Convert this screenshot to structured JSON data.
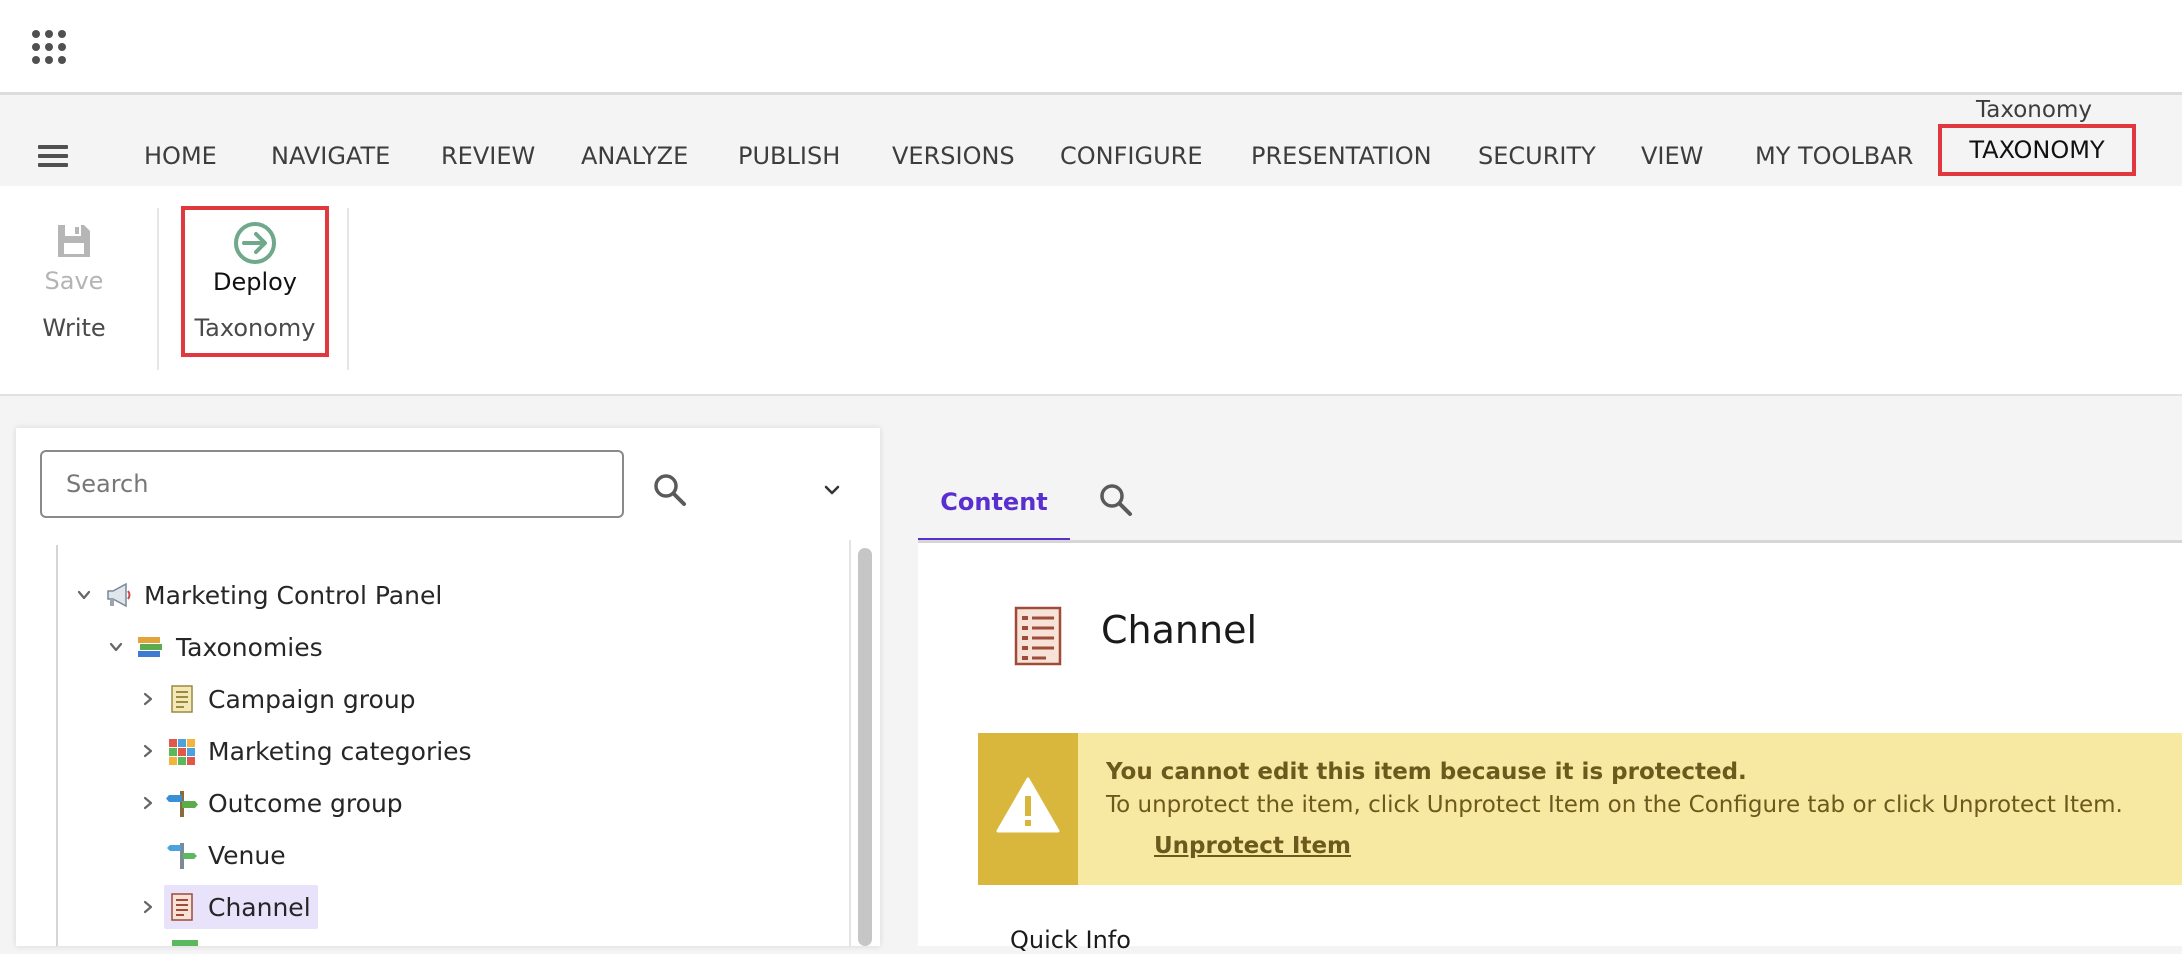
{
  "topbar": {
    "app_launcher_icon": "grid-icon"
  },
  "ribbon_tabs": {
    "menu_icon": "hamburger-icon",
    "items": [
      {
        "label": "HOME"
      },
      {
        "label": "NAVIGATE"
      },
      {
        "label": "REVIEW"
      },
      {
        "label": "ANALYZE"
      },
      {
        "label": "PUBLISH"
      },
      {
        "label": "VERSIONS"
      },
      {
        "label": "CONFIGURE"
      },
      {
        "label": "PRESENTATION"
      },
      {
        "label": "SECURITY"
      },
      {
        "label": "VIEW"
      },
      {
        "label": "MY TOOLBAR"
      }
    ],
    "contextual_group_label": "Taxonomy",
    "active_tab": {
      "label": "TAXONOMY",
      "highlighted": true
    }
  },
  "ribbon": {
    "write_group": {
      "button_label": "Save",
      "group_label": "Write",
      "icon": "floppy-disk-icon",
      "enabled": false
    },
    "taxonomy_group": {
      "button_label": "Deploy",
      "group_label": "Taxonomy",
      "icon": "arrow-circle-right-icon",
      "highlighted": true
    }
  },
  "tree": {
    "search": {
      "placeholder": "Search",
      "value": ""
    },
    "search_icon": "search-icon",
    "dropdown_icon": "chevron-down-icon",
    "rows": [
      {
        "label": "Marketing Control Panel",
        "icon": "megaphone-icon",
        "expanded": true
      },
      {
        "label": "Taxonomies",
        "icon": "books-icon",
        "expanded": true
      },
      {
        "label": "Campaign group",
        "icon": "list-document-icon",
        "expanded": false
      },
      {
        "label": "Marketing categories",
        "icon": "cubes-icon",
        "expanded": false
      },
      {
        "label": "Outcome group",
        "icon": "signpost-icon",
        "expanded": false
      },
      {
        "label": "Venue",
        "icon": "direction-sign-icon",
        "expanded": null
      },
      {
        "label": "Channel",
        "icon": "list-document-icon",
        "expanded": false,
        "selected": true
      }
    ]
  },
  "content": {
    "tabs": [
      {
        "label": "Content",
        "active": true
      }
    ],
    "search_icon": "search-icon",
    "item": {
      "title": "Channel",
      "icon": "list-document-icon"
    },
    "warning": {
      "icon": "warning-triangle-icon",
      "title": "You cannot edit this item because it is protected.",
      "text": "To unprotect the item, click Unprotect Item on the Configure tab or click Unprotect Item.",
      "link": "Unprotect Item"
    },
    "section_heading": "Quick Info"
  },
  "colors": {
    "accent_purple": "#5a2fd1",
    "highlight_red": "#e0383e",
    "warning_bg": "#f8e9a2",
    "warning_side": "#d9b63c",
    "selection_bg": "#e9e2fb"
  }
}
